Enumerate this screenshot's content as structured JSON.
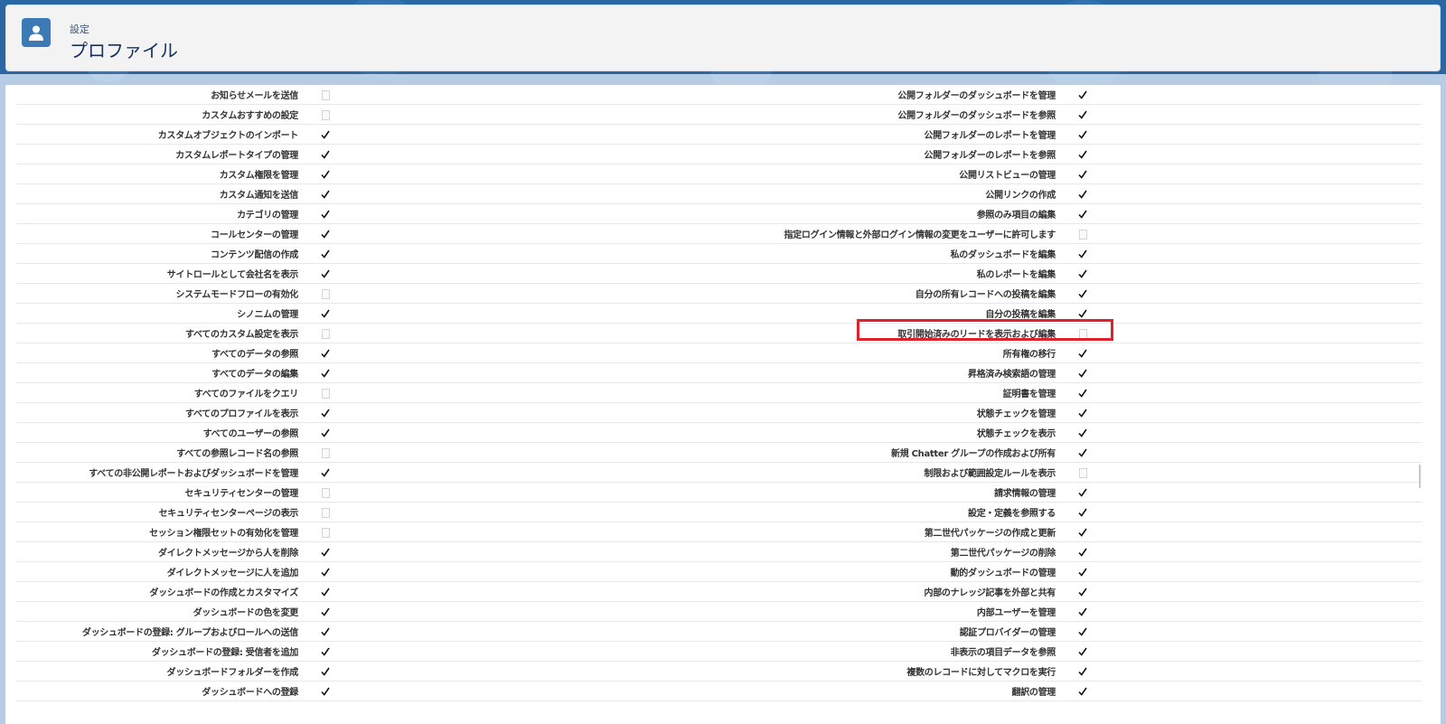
{
  "header": {
    "eyebrow": "設定",
    "title": "プロファイル",
    "icon": "user-icon"
  },
  "colors": {
    "brand_blue": "#2a67a3",
    "header_icon_bg": "#3c7ab5",
    "highlight_red": "#e0202a"
  },
  "highlight": {
    "label": "取引開始済みのリードを表示および編集"
  },
  "permissions": {
    "left": [
      {
        "label": "お知らせメールを送信",
        "checked": false
      },
      {
        "label": "カスタムおすすめの設定",
        "checked": false
      },
      {
        "label": "カスタムオブジェクトのインポート",
        "checked": true
      },
      {
        "label": "カスタムレポートタイプの管理",
        "checked": true
      },
      {
        "label": "カスタム権限を管理",
        "checked": true
      },
      {
        "label": "カスタム通知を送信",
        "checked": true
      },
      {
        "label": "カテゴリの管理",
        "checked": true
      },
      {
        "label": "コールセンターの管理",
        "checked": true
      },
      {
        "label": "コンテンツ配信の作成",
        "checked": true
      },
      {
        "label": "サイトロールとして会社名を表示",
        "checked": true
      },
      {
        "label": "システムモードフローの有効化",
        "checked": false
      },
      {
        "label": "シノニムの管理",
        "checked": true
      },
      {
        "label": "すべてのカスタム設定を表示",
        "checked": false
      },
      {
        "label": "すべてのデータの参照",
        "checked": true
      },
      {
        "label": "すべてのデータの編集",
        "checked": true
      },
      {
        "label": "すべてのファイルをクエリ",
        "checked": false
      },
      {
        "label": "すべてのプロファイルを表示",
        "checked": true
      },
      {
        "label": "すべてのユーザーの参照",
        "checked": true
      },
      {
        "label": "すべての参照レコード名の参照",
        "checked": false
      },
      {
        "label": "すべての非公開レポートおよびダッシュボードを管理",
        "checked": true
      },
      {
        "label": "セキュリティセンターの管理",
        "checked": false
      },
      {
        "label": "セキュリティセンターページの表示",
        "checked": false
      },
      {
        "label": "セッション権限セットの有効化を管理",
        "checked": false
      },
      {
        "label": "ダイレクトメッセージから人を削除",
        "checked": true
      },
      {
        "label": "ダイレクトメッセージに人を追加",
        "checked": true
      },
      {
        "label": "ダッシュボードの作成とカスタマイズ",
        "checked": true
      },
      {
        "label": "ダッシュボードの色を変更",
        "checked": true
      },
      {
        "label": "ダッシュボードの登録: グループおよびロールへの送信",
        "checked": true
      },
      {
        "label": "ダッシュボードの登録: 受信者を追加",
        "checked": true
      },
      {
        "label": "ダッシュボードフォルダーを作成",
        "checked": true
      },
      {
        "label": "ダッシュボードへの登録",
        "checked": true
      }
    ],
    "right": [
      {
        "label": "公開フォルダーのダッシュボードを管理",
        "checked": true
      },
      {
        "label": "公開フォルダーのダッシュボードを参照",
        "checked": true
      },
      {
        "label": "公開フォルダーのレポートを管理",
        "checked": true
      },
      {
        "label": "公開フォルダーのレポートを参照",
        "checked": true
      },
      {
        "label": "公開リストビューの管理",
        "checked": true
      },
      {
        "label": "公開リンクの作成",
        "checked": true
      },
      {
        "label": "参照のみ項目の編集",
        "checked": true
      },
      {
        "label": "指定ログイン情報と外部ログイン情報の変更をユーザーに許可します",
        "checked": false
      },
      {
        "label": "私のダッシュボードを編集",
        "checked": true
      },
      {
        "label": "私のレポートを編集",
        "checked": true
      },
      {
        "label": "自分の所有レコードへの投稿を編集",
        "checked": true
      },
      {
        "label": "自分の投稿を編集",
        "checked": true
      },
      {
        "label": "取引開始済みのリードを表示および編集",
        "checked": false
      },
      {
        "label": "所有権の移行",
        "checked": true
      },
      {
        "label": "昇格済み検索語の管理",
        "checked": true
      },
      {
        "label": "証明書を管理",
        "checked": true
      },
      {
        "label": "状態チェックを管理",
        "checked": true
      },
      {
        "label": "状態チェックを表示",
        "checked": true
      },
      {
        "label": "新規 Chatter グループの作成および所有",
        "checked": true
      },
      {
        "label": "制限および範囲設定ルールを表示",
        "checked": false
      },
      {
        "label": "請求情報の管理",
        "checked": true
      },
      {
        "label": "設定・定義を参照する",
        "checked": true
      },
      {
        "label": "第二世代パッケージの作成と更新",
        "checked": true
      },
      {
        "label": "第二世代パッケージの削除",
        "checked": true
      },
      {
        "label": "動的ダッシュボードの管理",
        "checked": true
      },
      {
        "label": "内部のナレッジ記事を外部と共有",
        "checked": true
      },
      {
        "label": "内部ユーザーを管理",
        "checked": true
      },
      {
        "label": "認証プロバイダーの管理",
        "checked": true
      },
      {
        "label": "非表示の項目データを参照",
        "checked": true
      },
      {
        "label": "複数のレコードに対してマクロを実行",
        "checked": true
      },
      {
        "label": "翻訳の管理",
        "checked": true
      }
    ]
  }
}
